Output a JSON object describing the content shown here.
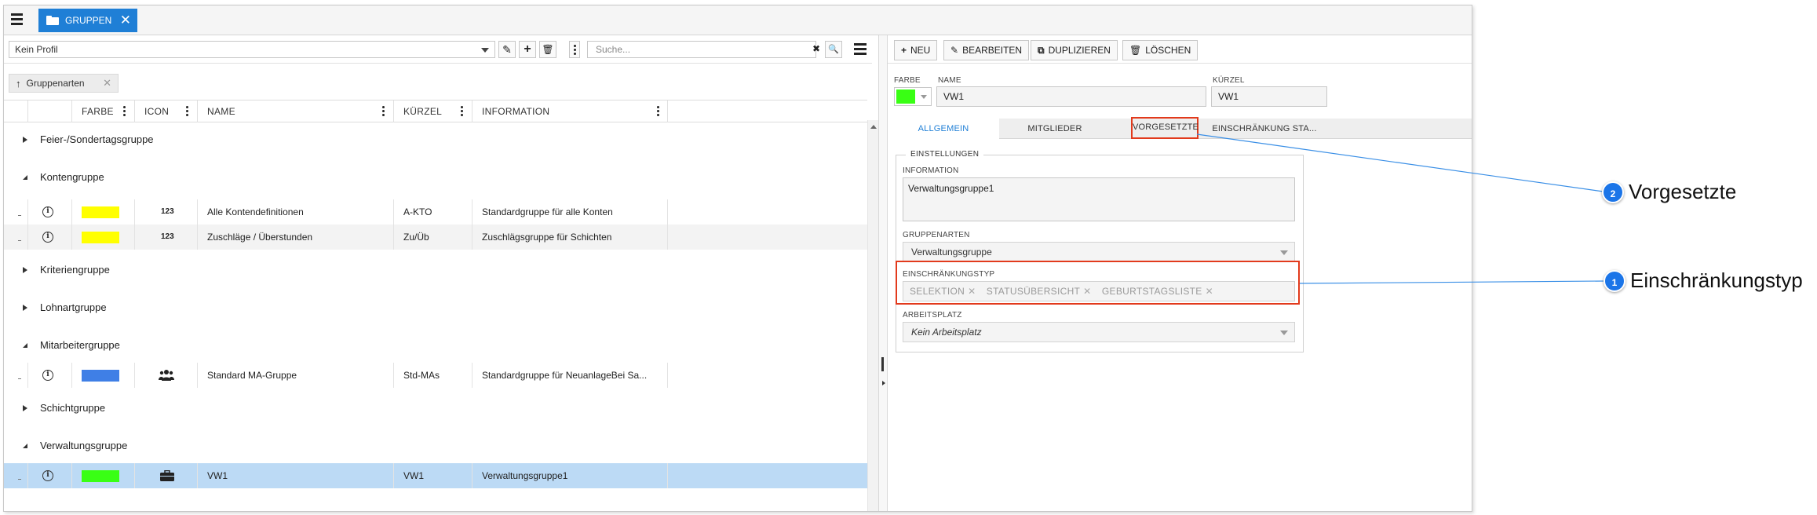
{
  "topbar": {
    "tab_label": "GRUPPEN",
    "close_glyph": "✕"
  },
  "left": {
    "profile": {
      "value": "Kein Profil"
    },
    "toolbar": {
      "edit_glyph": "✎",
      "add_glyph": "+",
      "delete_glyph": "🗑"
    },
    "search": {
      "placeholder": "Suche...",
      "clear_glyph": "✖",
      "search_glyph": "🔍"
    },
    "breadcrumb": {
      "arrow": "↑",
      "label": "Gruppenarten",
      "close": "✕"
    },
    "columns": [
      {
        "label": ""
      },
      {
        "label": ""
      },
      {
        "label": "FARBE"
      },
      {
        "label": "ICON"
      },
      {
        "label": "NAME"
      },
      {
        "label": "KÜRZEL"
      },
      {
        "label": "INFORMATION"
      }
    ],
    "groups": [
      {
        "label": "Feier-/Sondertagsgruppe",
        "expanded": false
      },
      {
        "label": "Kontengruppe",
        "expanded": true
      },
      {
        "label": "Kriteriengruppe",
        "expanded": false
      },
      {
        "label": "Lohnartgruppe",
        "expanded": false
      },
      {
        "label": "Mitarbeitergruppe",
        "expanded": true
      },
      {
        "label": "Schichtgruppe",
        "expanded": false
      },
      {
        "label": "Verwaltungsgruppe",
        "expanded": true
      }
    ],
    "rows": [
      {
        "info": "i",
        "color": "#ffff00",
        "icon": "123",
        "name": "Alle Kontendefinitionen",
        "kuerzel": "A-KTO",
        "information": "Standardgruppe für alle Konten"
      },
      {
        "info": "i",
        "color": "#ffff00",
        "icon": "123",
        "name": "Zuschläge / Überstunden",
        "kuerzel": "Zu/Üb",
        "information": "Zuschlägsgruppe für Schichten"
      },
      {
        "info": "i",
        "color": "#3f7fe6",
        "icon": "people-icon",
        "name": "Standard MA-Gruppe",
        "kuerzel": "Std-MAs",
        "information": "Standardgruppe für NeuanlageBei Sa..."
      },
      {
        "info": "i",
        "color": "#39ff14",
        "icon": "briefcase-icon",
        "name": "VW1",
        "kuerzel": "VW1",
        "information": "Verwaltungsgruppe1"
      }
    ]
  },
  "right": {
    "actions": [
      {
        "icon": "+",
        "label": "NEU"
      },
      {
        "icon": "✎",
        "label": "BEARBEITEN"
      },
      {
        "icon": "⧉",
        "label": "DUPLIZIEREN"
      },
      {
        "icon": "🗑",
        "label": "LÖSCHEN"
      }
    ],
    "labels": {
      "farbe": "FARBE",
      "name": "NAME",
      "kuerzel": "KÜRZEL"
    },
    "values": {
      "color": "#39ff14",
      "name": "VW1",
      "kuerzel": "VW1"
    },
    "tabs": [
      {
        "label": "ALLGEMEIN",
        "active": true
      },
      {
        "label": "MITGLIEDER"
      },
      {
        "label": "VORGESETZTE",
        "highlighted": true
      },
      {
        "label": "EINSCHRÄNKUNG STA..."
      }
    ],
    "settings": {
      "legend": "EINSTELLUNGEN",
      "information_label": "INFORMATION",
      "information_value": "Verwaltungsgruppe1",
      "gruppenarten_label": "GRUPPENARTEN",
      "gruppenarten_value": "Verwaltungsgruppe",
      "einschraenkung_label": "EINSCHRÄNKUNGSTYP",
      "einschraenkung_tags": [
        "SELEKTION",
        "STATUSÜBERSICHT",
        "GEBURTSTAGSLISTE"
      ],
      "tag_close": "✕",
      "arbeitsplatz_label": "ARBEITSPLATZ",
      "arbeitsplatz_value": "Kein Arbeitsplatz"
    }
  },
  "callouts": [
    {
      "number": "2",
      "text": "Vorgesetzte"
    },
    {
      "number": "1",
      "text": "Einschränkungstyp"
    }
  ],
  "colors": {
    "accent": "#1f7fd6",
    "highlight": "#e23a1c",
    "badge": "#1b75e8",
    "selected_row": "#bcdaf5"
  }
}
